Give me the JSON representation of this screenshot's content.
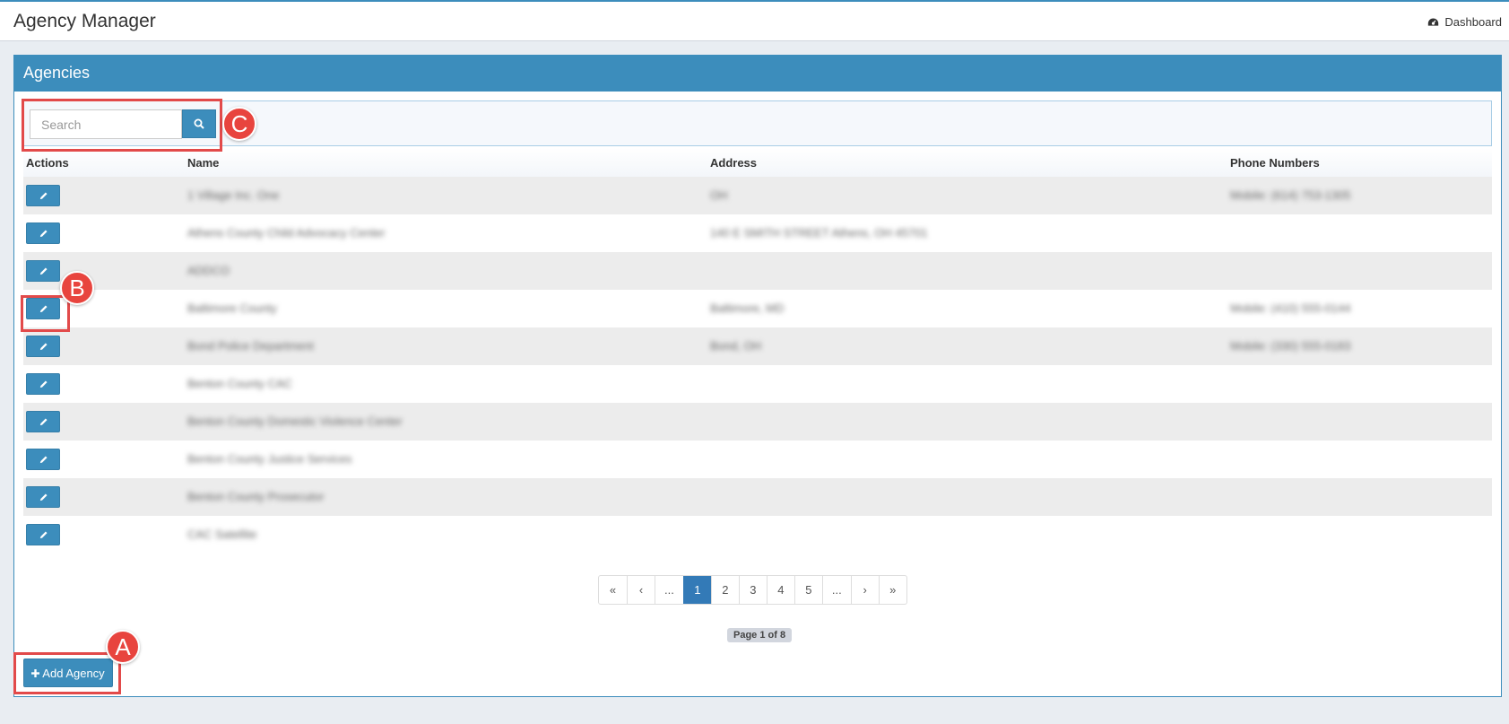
{
  "header": {
    "app_title": "Agency Manager",
    "dashboard_label": "Dashboard"
  },
  "panel": {
    "title": "Agencies"
  },
  "search": {
    "placeholder": "Search"
  },
  "table": {
    "columns": [
      "Actions",
      "Name",
      "Address",
      "Phone Numbers"
    ],
    "rows": [
      {
        "name": "1 Village Inc. One",
        "address": "OH",
        "phone": "Mobile: (614) 753-1305"
      },
      {
        "name": "Athens County Child Advocacy Center",
        "address": "140 E SMITH STREET Athens, OH 45701",
        "phone": ""
      },
      {
        "name": "ADDCO",
        "address": "",
        "phone": ""
      },
      {
        "name": "Baltimore County",
        "address": "Baltimore, MD",
        "phone": "Mobile: (410) 555-0144"
      },
      {
        "name": "Bond Police Department",
        "address": "Bond, OH",
        "phone": "Mobile: (330) 555-0183"
      },
      {
        "name": "Benton County CAC",
        "address": "",
        "phone": ""
      },
      {
        "name": "Benton County Domestic Violence Center",
        "address": "",
        "phone": ""
      },
      {
        "name": "Benton County Justice Services",
        "address": "",
        "phone": ""
      },
      {
        "name": "Benton County Prosecutor",
        "address": "",
        "phone": ""
      },
      {
        "name": "CAC Satellite",
        "address": "",
        "phone": ""
      }
    ]
  },
  "pagination": {
    "first": "«",
    "prev": "‹",
    "ellipsis_left": "...",
    "pages": [
      "1",
      "2",
      "3",
      "4",
      "5"
    ],
    "ellipsis_right": "...",
    "next": "›",
    "last": "»",
    "current_page": 1,
    "page_label": "Page 1 of 8"
  },
  "actions": {
    "add_label": "Add Agency"
  },
  "annotations": {
    "a": "A",
    "b": "B",
    "c": "C"
  },
  "colors": {
    "primary": "#3c8dbc",
    "highlight": "#e24a4a",
    "active_page": "#337ab7"
  },
  "icons": [
    "dashboard-icon",
    "search-icon",
    "pencil-icon",
    "plus-icon"
  ]
}
